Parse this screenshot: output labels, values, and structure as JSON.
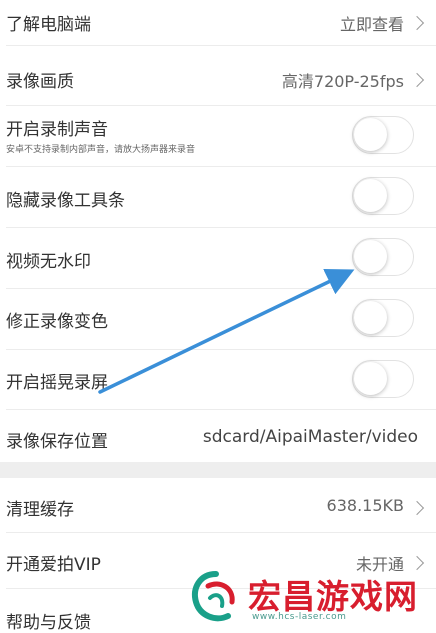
{
  "settings": {
    "learn_pc": {
      "label": "了解电脑端",
      "value": "立即查看"
    },
    "video_quality": {
      "label": "录像画质",
      "value": "高清720P-25fps"
    },
    "record_sound": {
      "label": "开启录制声音",
      "sub": "安卓不支持录制内部声音，请放大扬声器来录音",
      "on": false
    },
    "hide_toolbar": {
      "label": "隐藏录像工具条",
      "on": false
    },
    "no_watermark": {
      "label": "视频无水印",
      "on": false
    },
    "fix_color": {
      "label": "修正录像变色",
      "on": false
    },
    "shake_record": {
      "label": "开启摇晃录屏",
      "on": false
    },
    "save_location": {
      "label": "录像保存位置",
      "value": "sdcard/AipaiMaster/video"
    },
    "clear_cache": {
      "label": "清理缓存",
      "value": "638.15KB"
    },
    "vip": {
      "label": "开通爱拍VIP",
      "value": "未开通"
    },
    "help": {
      "label": "帮助与反馈"
    }
  },
  "colors": {
    "arrow": "#3a8fd8",
    "background_gap": "#eeeeee",
    "watermark": "#d81e2e"
  },
  "watermark": {
    "brand": "宏昌游戏网",
    "url": "www.hcs-laser.com"
  }
}
